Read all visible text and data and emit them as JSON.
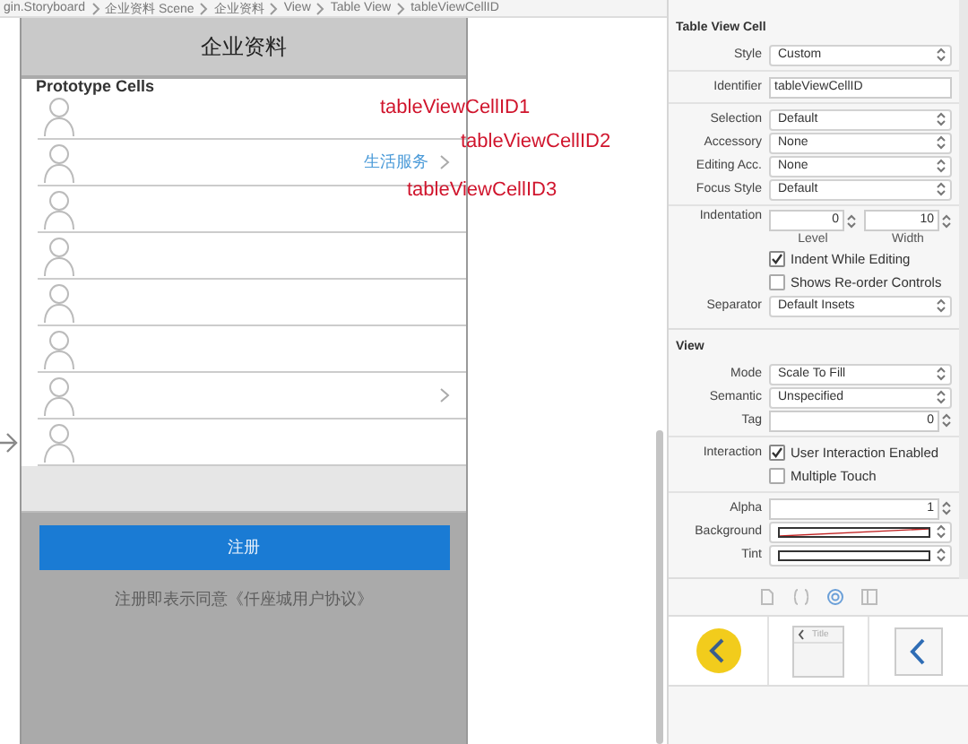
{
  "breadcrumb": [
    "gin.Storyboard",
    "企业资料 Scene",
    "企业资料",
    "View",
    "Table View",
    "tableViewCellID"
  ],
  "phone": {
    "nav_title": "企业资料",
    "section_header": "Prototype Cells",
    "cells": [
      {
        "disclosure": false,
        "annotation": "tableViewCellID1"
      },
      {
        "disclosure": true,
        "detail": "生活服务",
        "annotation": "tableViewCellID2"
      },
      {
        "disclosure": false,
        "annotation": "tableViewCellID3"
      },
      {
        "disclosure": false
      },
      {
        "disclosure": false
      },
      {
        "disclosure": false
      },
      {
        "disclosure": true
      },
      {
        "disclosure": false
      }
    ],
    "button": "注册",
    "agreement": "注册即表示同意《仟座城用户协议》"
  },
  "inspector": {
    "sections": [
      {
        "title": "Table View Cell",
        "groups": [
          [
            {
              "kind": "popup",
              "label": "Style",
              "value": "Custom"
            }
          ],
          [
            {
              "kind": "text",
              "label": "Identifier",
              "value": "tableViewCellID"
            }
          ],
          [
            {
              "kind": "popup",
              "label": "Selection",
              "value": "Default"
            },
            {
              "kind": "popup",
              "label": "Accessory",
              "value": "None"
            },
            {
              "kind": "popup",
              "label": "Editing Acc.",
              "value": "None"
            },
            {
              "kind": "popup",
              "label": "Focus Style",
              "value": "Default"
            }
          ],
          [
            {
              "kind": "stepper_pair",
              "label": "Indentation",
              "fields": [
                {
                  "value": "0",
                  "caption": "Level"
                },
                {
                  "value": "10",
                  "caption": "Width"
                }
              ]
            },
            {
              "kind": "checkbox",
              "text": "Indent While Editing",
              "checked": true
            },
            {
              "kind": "checkbox",
              "text": "Shows Re-order Controls",
              "checked": false
            },
            {
              "kind": "popup",
              "label": "Separator",
              "value": "Default Insets"
            }
          ]
        ]
      },
      {
        "title": "View",
        "groups": [
          [
            {
              "kind": "popup",
              "label": "Mode",
              "value": "Scale To Fill"
            },
            {
              "kind": "popup",
              "label": "Semantic",
              "value": "Unspecified"
            },
            {
              "kind": "stepper",
              "label": "Tag",
              "value": "0"
            }
          ],
          [
            {
              "kind": "checkbox",
              "label": "Interaction",
              "text": "User Interaction Enabled",
              "checked": true
            },
            {
              "kind": "checkbox",
              "text": "Multiple Touch",
              "checked": false
            }
          ],
          [
            {
              "kind": "stepper",
              "label": "Alpha",
              "value": "1"
            },
            {
              "kind": "color",
              "label": "Background",
              "clear": true
            },
            {
              "kind": "color",
              "label": "Tint",
              "clear": false
            }
          ]
        ]
      }
    ]
  },
  "library": [
    {
      "kind": "round-back"
    },
    {
      "kind": "nav-bar",
      "title": "Title"
    },
    {
      "kind": "back-button"
    }
  ]
}
